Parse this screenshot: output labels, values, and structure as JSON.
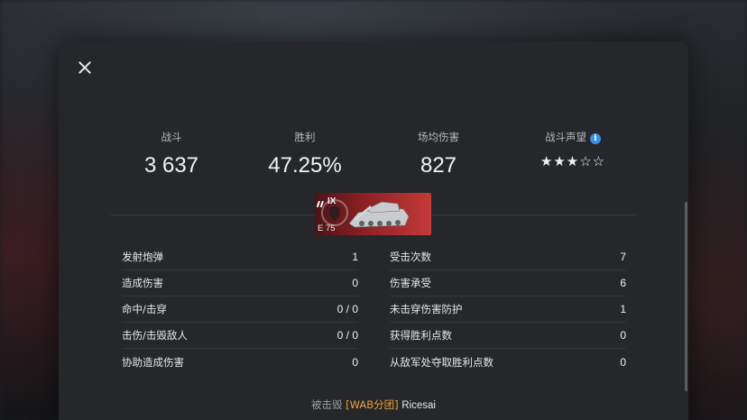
{
  "summary": {
    "battles": {
      "label": "战斗",
      "value": "3 637"
    },
    "wins": {
      "label": "胜利",
      "value": "47.25%"
    },
    "avg_damage": {
      "label": "场均伤害",
      "value": "827"
    },
    "reputation": {
      "label": "战斗声望",
      "stars_filled": 3,
      "stars_total": 5,
      "stars_text": "★★★☆☆"
    }
  },
  "tank": {
    "tier": "IX",
    "name": "E 75"
  },
  "left_stats": [
    {
      "label": "发射炮弹",
      "value": "1"
    },
    {
      "label": "造成伤害",
      "value": "0"
    },
    {
      "label": "命中/击穿",
      "value": "0 / 0"
    },
    {
      "label": "击伤/击毁敌人",
      "value": "0 / 0"
    },
    {
      "label": "协助造成伤害",
      "value": "0"
    }
  ],
  "right_stats": [
    {
      "label": "受击次数",
      "value": "7"
    },
    {
      "label": "伤害承受",
      "value": "6"
    },
    {
      "label": "未击穿伤害防护",
      "value": "1"
    },
    {
      "label": "获得胜利点数",
      "value": "0"
    },
    {
      "label": "从敌军处夺取胜利点数",
      "value": "0"
    }
  ],
  "footer": {
    "prefix": "被击毁",
    "clan": "[WAB分团]",
    "player": "Ricesai"
  },
  "colors": {
    "accent": "#e9a23b",
    "info": "#3a8ee6",
    "tank_banner": "#c43a38"
  },
  "icons": {
    "close": "close-icon",
    "info": "info-icon",
    "nation": "germany-emblem-icon",
    "tank": "tank-icon"
  }
}
